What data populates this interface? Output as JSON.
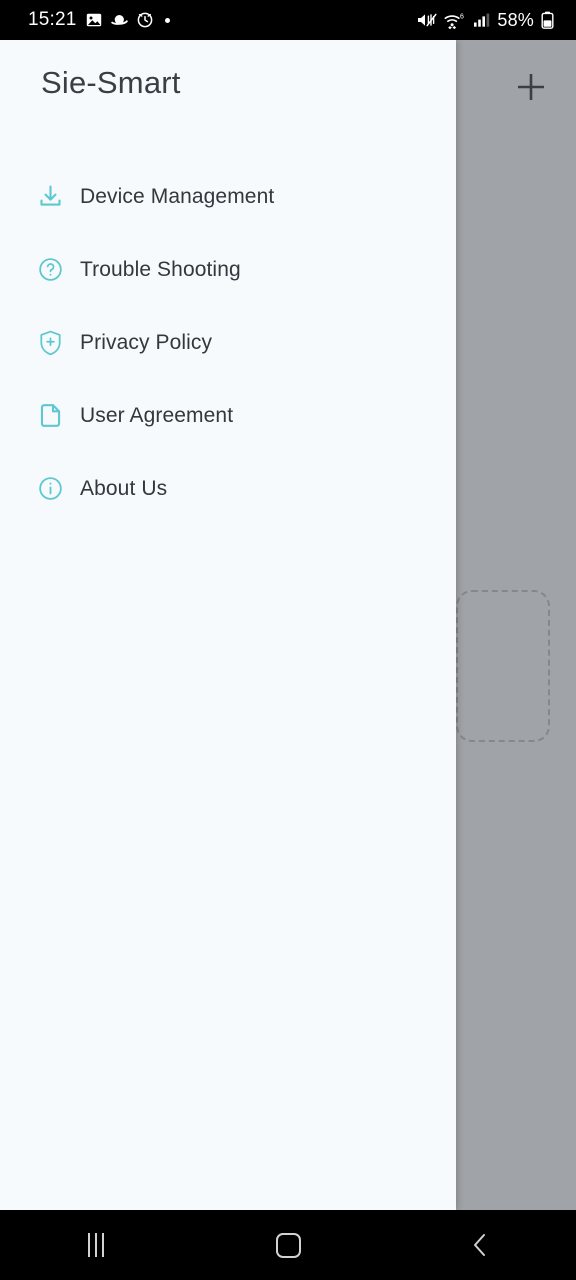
{
  "status_bar": {
    "time": "15:21",
    "battery_percent": "58%",
    "left_icons": [
      "photo-icon",
      "saturn-icon",
      "alarm-clock-icon",
      "dot-indicator-icon"
    ],
    "right_icons": [
      "mute-icon",
      "wifi-6-icon",
      "cellular-signal-icon",
      "battery-icon"
    ],
    "wifi_generation": "6",
    "background_color": "#000000",
    "text_color": "#ffffff"
  },
  "drawer": {
    "title": "Sie-Smart",
    "background_color": "#f6fafd",
    "title_color": "#3a3f45",
    "icon_color": "#5ec8d0",
    "label_color": "#33383e",
    "items": [
      {
        "label": "Device Management",
        "icon": "download-tray-icon"
      },
      {
        "label": "Trouble Shooting",
        "icon": "question-circle-icon"
      },
      {
        "label": "Privacy Policy",
        "icon": "shield-plus-icon"
      },
      {
        "label": "User Agreement",
        "icon": "document-icon"
      },
      {
        "label": "About Us",
        "icon": "info-circle-icon"
      }
    ]
  },
  "backdrop": {
    "overlay_color": "#a0a3a7",
    "add_button_icon": "plus-icon",
    "add_button_label": "+",
    "placeholder_card_style": "dashed-rounded-rectangle"
  },
  "nav_bar": {
    "background_color": "#000000",
    "buttons": [
      {
        "name": "recents",
        "icon": "recents-icon"
      },
      {
        "name": "home",
        "icon": "home-icon"
      },
      {
        "name": "back",
        "icon": "back-chevron-icon"
      }
    ]
  }
}
